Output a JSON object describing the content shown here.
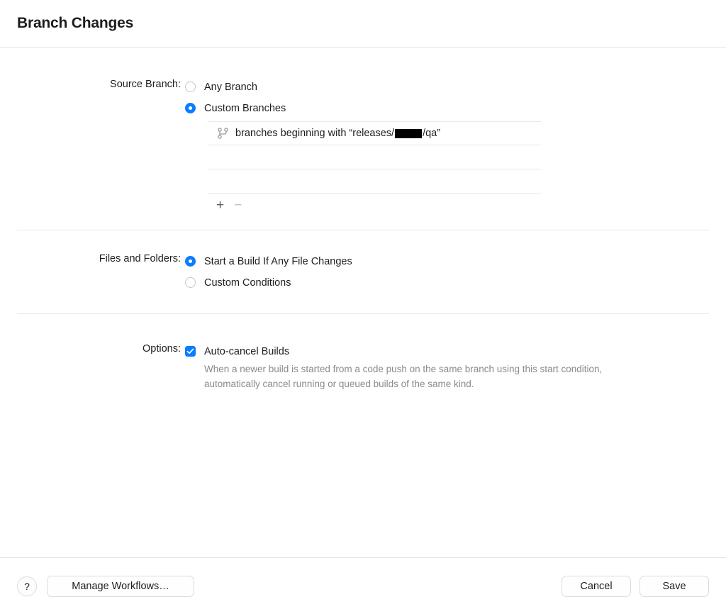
{
  "window": {
    "title": "Branch Changes"
  },
  "sections": {
    "source_branch": {
      "label": "Source Branch:",
      "options": [
        {
          "label": "Any Branch",
          "selected": false
        },
        {
          "label": "Custom Branches",
          "selected": true
        }
      ],
      "branch_rows": [
        {
          "icon": "git-branch-icon",
          "text_before": "branches beginning with “releases/",
          "redacted": true,
          "text_after": "/qa”"
        },
        {
          "icon": "",
          "text_before": "",
          "redacted": false,
          "text_after": ""
        },
        {
          "icon": "",
          "text_before": "",
          "redacted": false,
          "text_after": ""
        }
      ],
      "add_button": "+",
      "remove_button": "−"
    },
    "files_and_folders": {
      "label": "Files and Folders:",
      "options": [
        {
          "label": "Start a Build If Any File Changes",
          "selected": true
        },
        {
          "label": "Custom Conditions",
          "selected": false
        }
      ]
    },
    "options": {
      "label": "Options:",
      "checkbox_label": "Auto-cancel Builds",
      "checkbox_checked": true,
      "description": "When a newer build is started from a code push on the same branch using this start condition, automatically cancel running or queued builds of the same kind."
    }
  },
  "bottom_bar": {
    "help_label": "?",
    "manage_workflows_label": "Manage Workflows…",
    "cancel_label": "Cancel",
    "save_label": "Save"
  },
  "colors": {
    "accent": "#0a7cff",
    "text": "#1d1d1f",
    "muted_text": "#8a8a8e",
    "divider": "#e8e8e8",
    "redaction": "#000000"
  }
}
